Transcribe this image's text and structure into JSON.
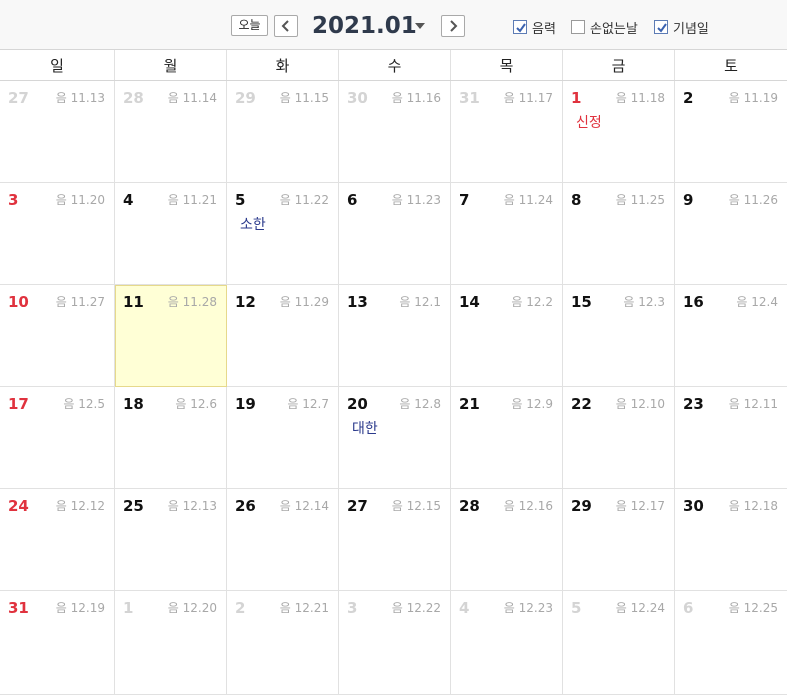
{
  "header": {
    "today_label": "오늘",
    "title": "2021.01",
    "options": [
      {
        "label": "음력",
        "checked": true
      },
      {
        "label": "손없는날",
        "checked": false
      },
      {
        "label": "기념일",
        "checked": true
      }
    ]
  },
  "colors": {
    "holiday": "#e0323e",
    "term": "#2b3a8c",
    "today_bg": "#ffffd6",
    "title": "#2f3a4c"
  },
  "weekdays": [
    "일",
    "월",
    "화",
    "수",
    "목",
    "금",
    "토"
  ],
  "weeks": [
    [
      {
        "day": "27",
        "lunar": "음 11.13",
        "muted": true
      },
      {
        "day": "28",
        "lunar": "음 11.14",
        "muted": true
      },
      {
        "day": "29",
        "lunar": "음 11.15",
        "muted": true
      },
      {
        "day": "30",
        "lunar": "음 11.16",
        "muted": true
      },
      {
        "day": "31",
        "lunar": "음 11.17",
        "muted": true
      },
      {
        "day": "1",
        "lunar": "음 11.18",
        "holiday": true,
        "event": "신정",
        "event_type": "holiday"
      },
      {
        "day": "2",
        "lunar": "음 11.19"
      }
    ],
    [
      {
        "day": "3",
        "lunar": "음 11.20",
        "holiday": true
      },
      {
        "day": "4",
        "lunar": "음 11.21"
      },
      {
        "day": "5",
        "lunar": "음 11.22",
        "event": "소한",
        "event_type": "term"
      },
      {
        "day": "6",
        "lunar": "음 11.23"
      },
      {
        "day": "7",
        "lunar": "음 11.24"
      },
      {
        "day": "8",
        "lunar": "음 11.25"
      },
      {
        "day": "9",
        "lunar": "음 11.26"
      }
    ],
    [
      {
        "day": "10",
        "lunar": "음 11.27",
        "holiday": true
      },
      {
        "day": "11",
        "lunar": "음 11.28",
        "today": true
      },
      {
        "day": "12",
        "lunar": "음 11.29"
      },
      {
        "day": "13",
        "lunar": "음 12.1"
      },
      {
        "day": "14",
        "lunar": "음 12.2"
      },
      {
        "day": "15",
        "lunar": "음 12.3"
      },
      {
        "day": "16",
        "lunar": "음 12.4"
      }
    ],
    [
      {
        "day": "17",
        "lunar": "음 12.5",
        "holiday": true
      },
      {
        "day": "18",
        "lunar": "음 12.6"
      },
      {
        "day": "19",
        "lunar": "음 12.7"
      },
      {
        "day": "20",
        "lunar": "음 12.8",
        "event": "대한",
        "event_type": "term"
      },
      {
        "day": "21",
        "lunar": "음 12.9"
      },
      {
        "day": "22",
        "lunar": "음 12.10"
      },
      {
        "day": "23",
        "lunar": "음 12.11"
      }
    ],
    [
      {
        "day": "24",
        "lunar": "음 12.12",
        "holiday": true
      },
      {
        "day": "25",
        "lunar": "음 12.13"
      },
      {
        "day": "26",
        "lunar": "음 12.14"
      },
      {
        "day": "27",
        "lunar": "음 12.15"
      },
      {
        "day": "28",
        "lunar": "음 12.16"
      },
      {
        "day": "29",
        "lunar": "음 12.17"
      },
      {
        "day": "30",
        "lunar": "음 12.18"
      }
    ],
    [
      {
        "day": "31",
        "lunar": "음 12.19",
        "holiday": true
      },
      {
        "day": "1",
        "lunar": "음 12.20",
        "muted": true
      },
      {
        "day": "2",
        "lunar": "음 12.21",
        "muted": true
      },
      {
        "day": "3",
        "lunar": "음 12.22",
        "muted": true
      },
      {
        "day": "4",
        "lunar": "음 12.23",
        "muted": true
      },
      {
        "day": "5",
        "lunar": "음 12.24",
        "muted": true
      },
      {
        "day": "6",
        "lunar": "음 12.25",
        "muted": true
      }
    ]
  ]
}
